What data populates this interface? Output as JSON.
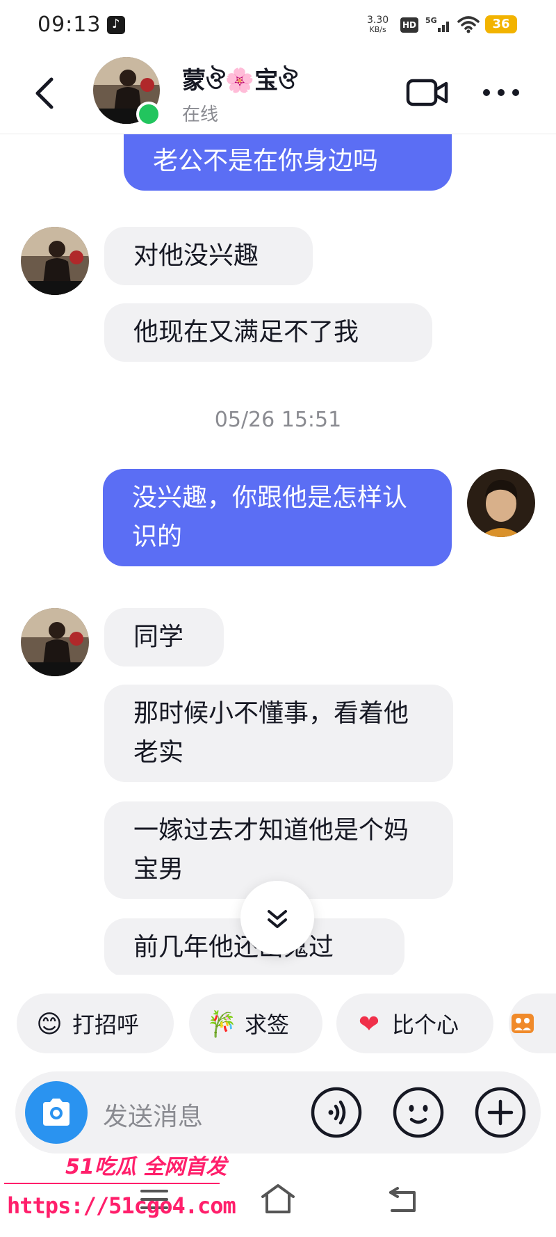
{
  "status_bar": {
    "time": "09:13",
    "net_speed_value": "3.30",
    "net_speed_unit": "KB/s",
    "hd": "HD",
    "network": "5G",
    "battery": "36"
  },
  "header": {
    "contact_name": "蒙ঔ🌸宝ঔ",
    "status": "在线"
  },
  "messages": [
    {
      "side": "out",
      "text": "老公不是在你身边吗"
    },
    {
      "side": "in",
      "text": "对他没兴趣"
    },
    {
      "side": "in",
      "text": "他现在又满足不了我"
    },
    {
      "type": "time",
      "text": "05/26 15:51"
    },
    {
      "side": "out",
      "text": "没兴趣，你跟他是怎样认识的"
    },
    {
      "side": "in",
      "text": "同学"
    },
    {
      "side": "in",
      "text": "那时候小不懂事，看着他老实"
    },
    {
      "side": "in",
      "text": "一嫁过去才知道他是个妈宝男"
    },
    {
      "side": "in",
      "text": "前几年他还出鬼过"
    }
  ],
  "quick_replies": [
    {
      "icon": "smile-emoji-icon",
      "label": "打招呼"
    },
    {
      "icon": "fortune-stick-icon",
      "label": "求签"
    },
    {
      "icon": "heart-icon",
      "label": "比个心"
    },
    {
      "icon": "photo-album-icon",
      "label": ""
    }
  ],
  "input": {
    "placeholder": "发送消息"
  },
  "watermark": {
    "brand": "51吃瓜 全网首发",
    "url": "https://51cgo4.com"
  },
  "colors": {
    "outgoing_bubble": "#5b6ef4",
    "incoming_bubble": "#f1f1f3",
    "online": "#22c55e",
    "camera": "#2a93f0",
    "watermark": "#ff1f6b"
  }
}
